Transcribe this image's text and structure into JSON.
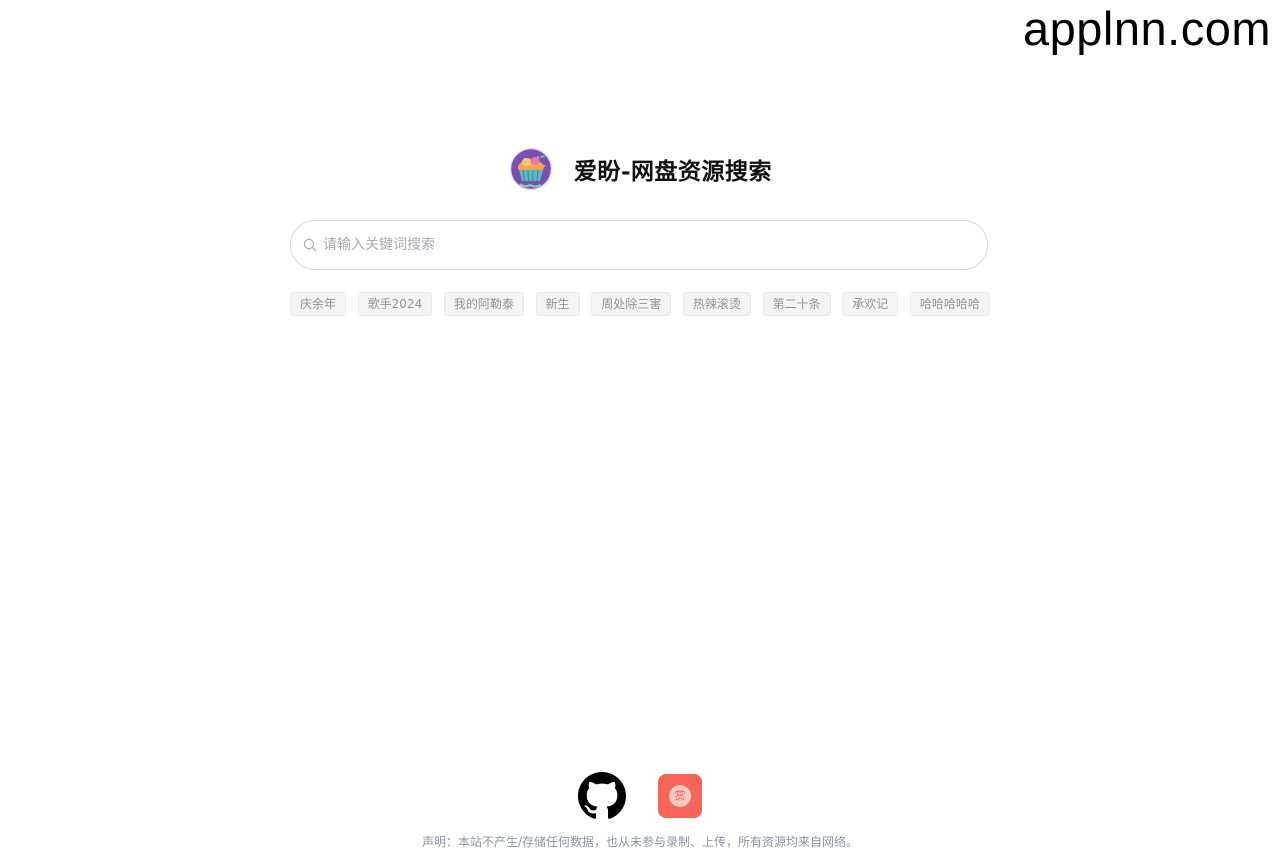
{
  "watermark": {
    "text": "applnn.com"
  },
  "header": {
    "logo_icon": "cupcake-logo-icon",
    "title": "爱盼-网盘资源搜索"
  },
  "search": {
    "icon": "search-icon",
    "placeholder": "请输入关键词搜索",
    "value": ""
  },
  "hot_tags": [
    {
      "label": "庆余年"
    },
    {
      "label": "歌手2024"
    },
    {
      "label": "我的阿勒泰"
    },
    {
      "label": "新生"
    },
    {
      "label": "周处除三害"
    },
    {
      "label": "热辣滚烫"
    },
    {
      "label": "第二十条"
    },
    {
      "label": "承欢记"
    },
    {
      "label": "哈哈哈哈哈"
    }
  ],
  "footer": {
    "github_icon": "github-icon",
    "reward_icon": "reward-icon",
    "reward_glyph": "赏",
    "disclaimer": "声明：本站不产生/存储任何数据，也从未参与录制、上传，所有资源均来自网络。"
  },
  "colors": {
    "reward_button": "#f76559",
    "tag_background": "#f4f4f5",
    "tag_text": "#909399",
    "search_border": "#d4d7de",
    "disclaimer_text": "#8a94a6"
  }
}
